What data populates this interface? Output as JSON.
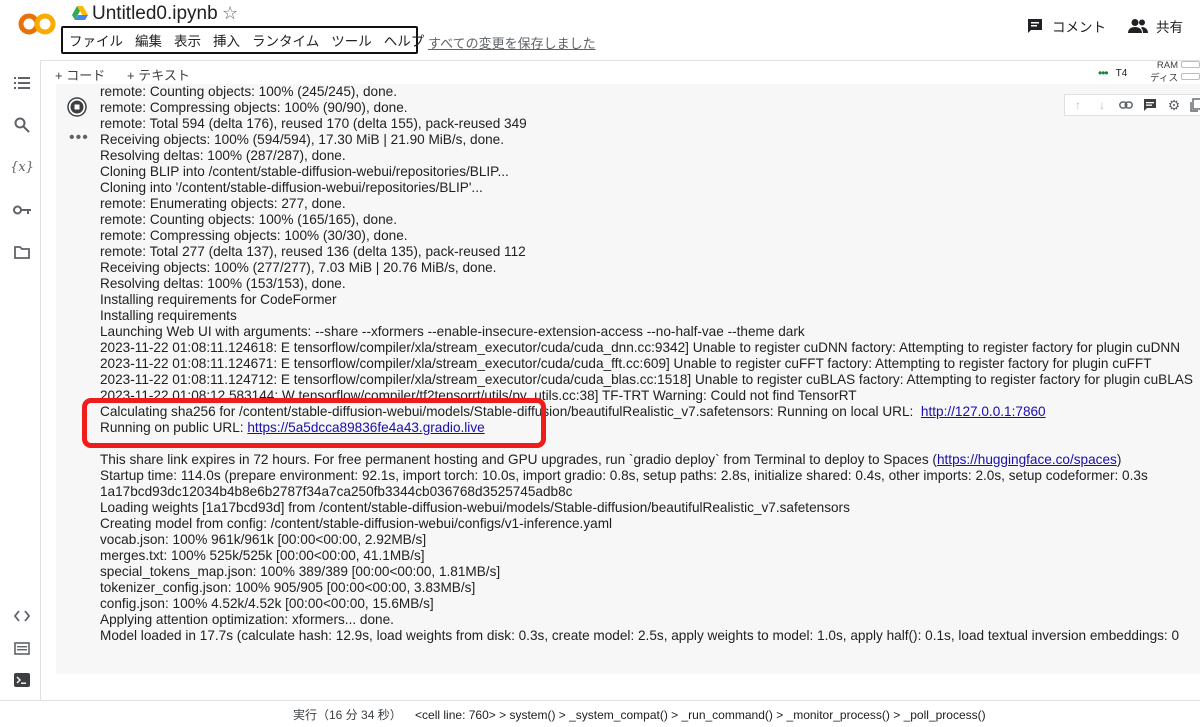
{
  "header": {
    "title": "Untitled0.ipynb",
    "menu": [
      "ファイル",
      "編集",
      "表示",
      "挿入",
      "ランタイム",
      "ツール",
      "ヘルプ"
    ],
    "save_status": "すべての変更を保存しました",
    "comment_label": "コメント",
    "share_label": "共有"
  },
  "toolbar": {
    "add_code": "+ コード",
    "add_text": "+ テキスト",
    "runtime": "T4",
    "ram_label": "RAM",
    "disk_label": "ディスク"
  },
  "output": {
    "lines_top": [
      "remote: Counting objects: 100% (245/245), done.",
      "remote: Compressing objects: 100% (90/90), done.",
      "remote: Total 594 (delta 176), reused 170 (delta 155), pack-reused 349",
      "Receiving objects: 100% (594/594), 17.30 MiB | 21.90 MiB/s, done.",
      "Resolving deltas: 100% (287/287), done.",
      "Cloning BLIP into /content/stable-diffusion-webui/repositories/BLIP...",
      "Cloning into '/content/stable-diffusion-webui/repositories/BLIP'...",
      "remote: Enumerating objects: 277, done.",
      "remote: Counting objects: 100% (165/165), done.",
      "remote: Compressing objects: 100% (30/30), done.",
      "remote: Total 277 (delta 137), reused 136 (delta 135), pack-reused 112",
      "Receiving objects: 100% (277/277), 7.03 MiB | 20.76 MiB/s, done.",
      "Resolving deltas: 100% (153/153), done.",
      "Installing requirements for CodeFormer",
      "Installing requirements",
      "Launching Web UI with arguments: --share --xformers --enable-insecure-extension-access --no-half-vae --theme dark",
      "2023-11-22 01:08:11.124618: E tensorflow/compiler/xla/stream_executor/cuda/cuda_dnn.cc:9342] Unable to register cuDNN factory: Attempting to register factory for plugin cuDNN",
      "2023-11-22 01:08:11.124671: E tensorflow/compiler/xla/stream_executor/cuda/cuda_fft.cc:609] Unable to register cuFFT factory: Attempting to register factory for plugin cuFFT",
      "2023-11-22 01:08:11.124712: E tensorflow/compiler/xla/stream_executor/cuda/cuda_blas.cc:1518] Unable to register cuBLAS factory: Attempting to register factory for plugin cuBLAS",
      "2023-11-22 01:08:12.583144: W tensorflow/compiler/tf2tensorrt/utils/py_utils.cc:38] TF-TRT Warning: Could not find TensorRT"
    ],
    "calc_line_prefix": "Calculating sha256 for /content/stable-diffusion-webui/models/Stable-diffusion/beautifulRealistic_v7.safetensors: Running on local URL:",
    "local_url": "http://127.0.0.1:7860",
    "public_prefix": "Running on public URL:",
    "public_url": "https://5a5dcca89836fe4a43.gradio.live",
    "share_line_prefix": "This share link expires in 72 hours. For free permanent hosting and GPU upgrades, run `gradio deploy` from Terminal to deploy to Spaces (",
    "share_link": "https://huggingface.co/spaces",
    "share_line_suffix": ")",
    "lines_bottom": [
      "Startup time: 114.0s (prepare environment: 92.1s, import torch: 10.0s, import gradio: 0.8s, setup paths: 2.8s, initialize shared: 0.4s, other imports: 2.0s, setup codeformer: 0.3s",
      "1a17bcd93dc12034b4b8e6b2787f34a7ca250fb3344cb036768d3525745adb8c",
      "Loading weights [1a17bcd93d] from /content/stable-diffusion-webui/models/Stable-diffusion/beautifulRealistic_v7.safetensors",
      "Creating model from config: /content/stable-diffusion-webui/configs/v1-inference.yaml",
      "vocab.json: 100% 961k/961k [00:00<00:00, 2.92MB/s]",
      "merges.txt: 100% 525k/525k [00:00<00:00, 41.1MB/s]",
      "special_tokens_map.json: 100% 389/389 [00:00<00:00, 1.81MB/s]",
      "tokenizer_config.json: 100% 905/905 [00:00<00:00, 3.83MB/s]",
      "config.json: 100% 4.52k/4.52k [00:00<00:00, 15.6MB/s]",
      "Applying attention optimization: xformers... done.",
      "Model loaded in 17.7s (calculate hash: 12.9s, load weights from disk: 0.3s, create model: 2.5s, apply weights to model: 1.0s, apply half(): 0.1s, load textual inversion embeddings: 0"
    ]
  },
  "status_bar": {
    "run_info": "実行（16 分 34 秒）",
    "trace": "<cell line: 760> > system() > _system_compat() > _run_command() > _monitor_process() > _poll_process()"
  },
  "colors": {
    "highlight": "#f01b1b",
    "link": "#1a0dab",
    "logo_orange": "#f9ab00",
    "logo_dark_orange": "#e8710a"
  },
  "icons": [
    "colab-logo",
    "drive-icon",
    "star-icon",
    "comment-icon",
    "share-icon",
    "toc-icon",
    "search-icon",
    "variables-icon",
    "key-icon",
    "folder-icon",
    "code-snippets-icon",
    "command-palette-icon",
    "terminal-icon",
    "stop-icon",
    "more-icon",
    "arrow-up-icon",
    "arrow-down-icon",
    "link-icon",
    "comment-cell-icon",
    "settings-icon",
    "copy-icon"
  ]
}
